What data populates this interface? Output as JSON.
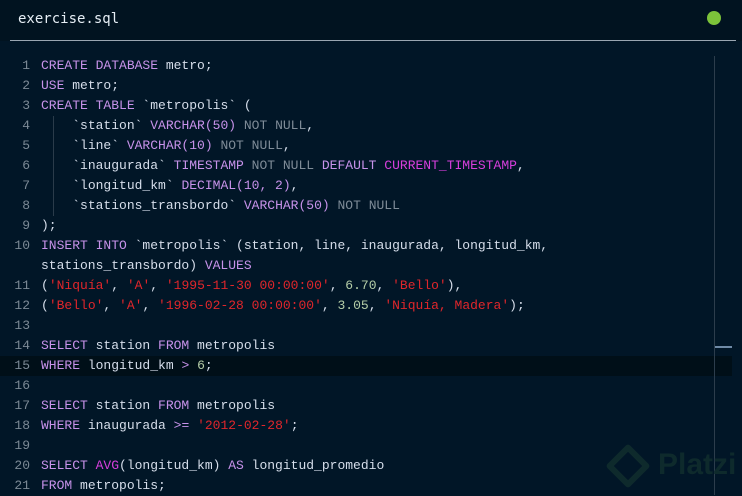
{
  "header": {
    "filename": "exercise.sql",
    "status_color": "#7cc33a"
  },
  "watermark": "Platzi",
  "highlighted_line": "15",
  "lines": [
    {
      "num": "1",
      "tokens": [
        [
          "k",
          "CREATE DATABASE"
        ],
        [
          "p",
          " metro;"
        ]
      ]
    },
    {
      "num": "2",
      "tokens": [
        [
          "k",
          "USE"
        ],
        [
          "p",
          " metro;"
        ]
      ]
    },
    {
      "num": "3",
      "tokens": [
        [
          "k",
          "CREATE TABLE"
        ],
        [
          "p",
          " `metropolis` ("
        ]
      ]
    },
    {
      "num": "4",
      "indent": true,
      "tokens": [
        [
          "p",
          "`station` "
        ],
        [
          "k",
          "VARCHAR(50)"
        ],
        [
          "d",
          " NOT NULL"
        ],
        [
          "p",
          ","
        ]
      ]
    },
    {
      "num": "5",
      "indent": true,
      "tokens": [
        [
          "p",
          "`line` "
        ],
        [
          "k",
          "VARCHAR(10)"
        ],
        [
          "d",
          " NOT NULL"
        ],
        [
          "p",
          ","
        ]
      ]
    },
    {
      "num": "6",
      "indent": true,
      "tokens": [
        [
          "p",
          "`inaugurada` "
        ],
        [
          "k",
          "TIMESTAMP"
        ],
        [
          "d",
          " NOT NULL "
        ],
        [
          "k",
          "DEFAULT "
        ],
        [
          "f",
          "CURRENT_TIMESTAMP"
        ],
        [
          "p",
          ","
        ]
      ]
    },
    {
      "num": "7",
      "indent": true,
      "tokens": [
        [
          "p",
          "`longitud_km` "
        ],
        [
          "k",
          "DECIMAL(10, 2)"
        ],
        [
          "p",
          ","
        ]
      ]
    },
    {
      "num": "8",
      "indent": true,
      "tokens": [
        [
          "p",
          "`stations_transbordo` "
        ],
        [
          "k",
          "VARCHAR(50)"
        ],
        [
          "d",
          " NOT NULL"
        ]
      ]
    },
    {
      "num": "9",
      "tokens": [
        [
          "p",
          ");"
        ]
      ]
    },
    {
      "num": "10",
      "tokens": [
        [
          "k",
          "INSERT INTO"
        ],
        [
          "p",
          " `metropolis` (station, line, inaugurada, longitud_km,"
        ]
      ]
    },
    {
      "num": "",
      "tokens": [
        [
          "p",
          "stations_transbordo) "
        ],
        [
          "k",
          "VALUES"
        ]
      ]
    },
    {
      "num": "11",
      "tokens": [
        [
          "p",
          "("
        ],
        [
          "s",
          "'Niquía'"
        ],
        [
          "p",
          ", "
        ],
        [
          "s",
          "'A'"
        ],
        [
          "p",
          ", "
        ],
        [
          "s",
          "'1995-11-30 00:00:00'"
        ],
        [
          "p",
          ", "
        ],
        [
          "n",
          "6.70"
        ],
        [
          "p",
          ", "
        ],
        [
          "s",
          "'Bello'"
        ],
        [
          "p",
          "),"
        ]
      ]
    },
    {
      "num": "12",
      "tokens": [
        [
          "p",
          "("
        ],
        [
          "s",
          "'Bello'"
        ],
        [
          "p",
          ", "
        ],
        [
          "s",
          "'A'"
        ],
        [
          "p",
          ", "
        ],
        [
          "s",
          "'1996-02-28 00:00:00'"
        ],
        [
          "p",
          ", "
        ],
        [
          "n",
          "3.05"
        ],
        [
          "p",
          ", "
        ],
        [
          "s",
          "'Niquía, Madera'"
        ],
        [
          "p",
          ");"
        ]
      ]
    },
    {
      "num": "13",
      "tokens": []
    },
    {
      "num": "14",
      "tokens": [
        [
          "k",
          "SELECT"
        ],
        [
          "p",
          " station "
        ],
        [
          "k",
          "FROM"
        ],
        [
          "p",
          " metropolis"
        ]
      ]
    },
    {
      "num": "15",
      "tokens": [
        [
          "k",
          "WHERE"
        ],
        [
          "p",
          " longitud_km "
        ],
        [
          "k",
          ">"
        ],
        [
          "p",
          " "
        ],
        [
          "n",
          "6"
        ],
        [
          "p",
          ";"
        ]
      ]
    },
    {
      "num": "16",
      "tokens": []
    },
    {
      "num": "17",
      "tokens": [
        [
          "k",
          "SELECT"
        ],
        [
          "p",
          " station "
        ],
        [
          "k",
          "FROM"
        ],
        [
          "p",
          " metropolis"
        ]
      ]
    },
    {
      "num": "18",
      "tokens": [
        [
          "k",
          "WHERE"
        ],
        [
          "p",
          " inaugurada "
        ],
        [
          "k",
          ">="
        ],
        [
          "p",
          " "
        ],
        [
          "s",
          "'2012-02-28'"
        ],
        [
          "p",
          ";"
        ]
      ]
    },
    {
      "num": "19",
      "tokens": []
    },
    {
      "num": "20",
      "tokens": [
        [
          "k",
          "SELECT "
        ],
        [
          "f",
          "AVG"
        ],
        [
          "p",
          "(longitud_km) "
        ],
        [
          "k",
          "AS"
        ],
        [
          "p",
          " longitud_promedio"
        ]
      ]
    },
    {
      "num": "21",
      "tokens": [
        [
          "k",
          "FROM"
        ],
        [
          "p",
          " metropolis;"
        ]
      ]
    }
  ]
}
